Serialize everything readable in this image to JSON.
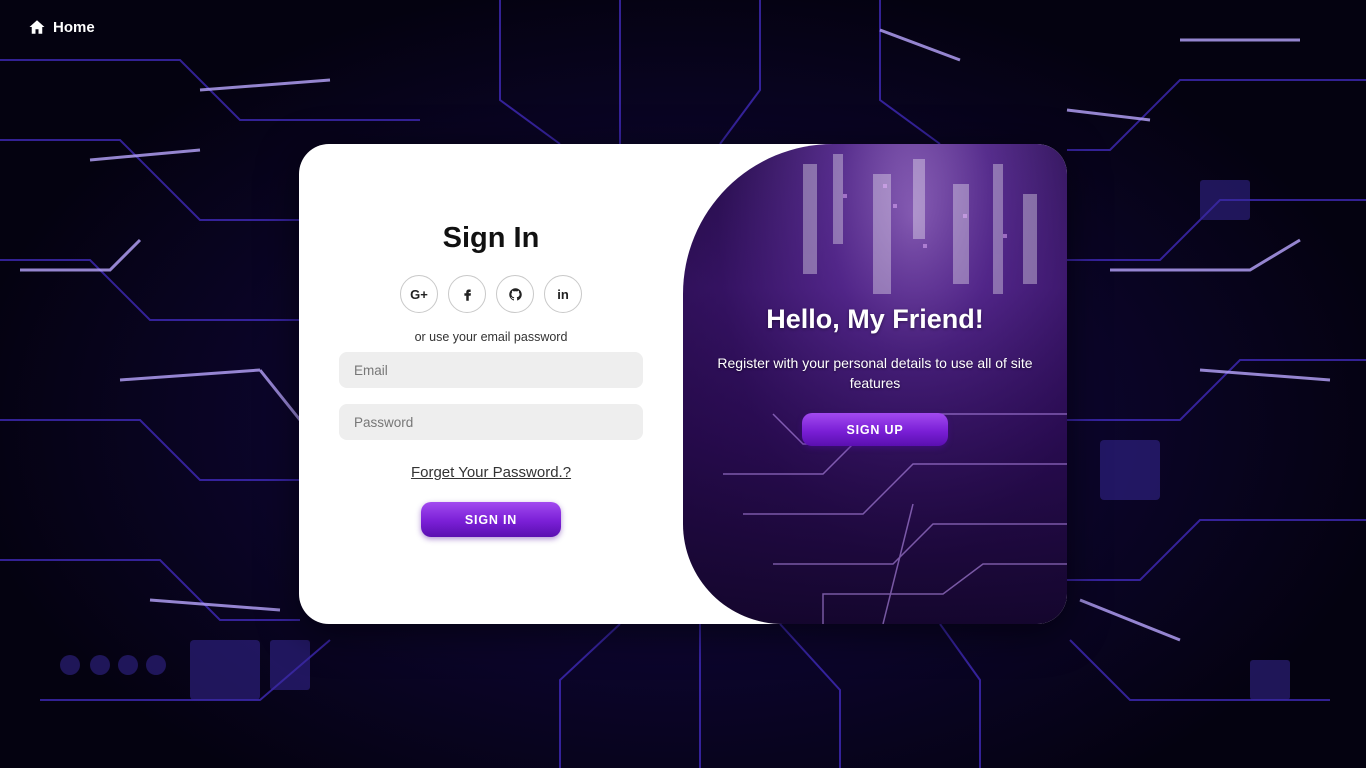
{
  "nav": {
    "home_label": "Home"
  },
  "signin": {
    "title": "Sign In",
    "socials": [
      {
        "icon": "google-plus-icon",
        "text": "G+"
      },
      {
        "icon": "facebook-icon",
        "text": ""
      },
      {
        "icon": "github-icon",
        "text": ""
      },
      {
        "icon": "linkedin-icon",
        "text": "in"
      }
    ],
    "hint": "or use your email password",
    "email_placeholder": "Email",
    "email_value": "",
    "password_placeholder": "Password",
    "password_value": "",
    "forgot_label": "Forget Your Password.?",
    "button_label": "SIGN IN"
  },
  "toggle": {
    "title": "Hello, My Friend!",
    "text": "Register with your personal details to use all of site features",
    "button_label": "SIGN UP"
  },
  "colors": {
    "accent": "#7a1fd6",
    "accent_light": "#a24af0",
    "background": "#05020d"
  }
}
